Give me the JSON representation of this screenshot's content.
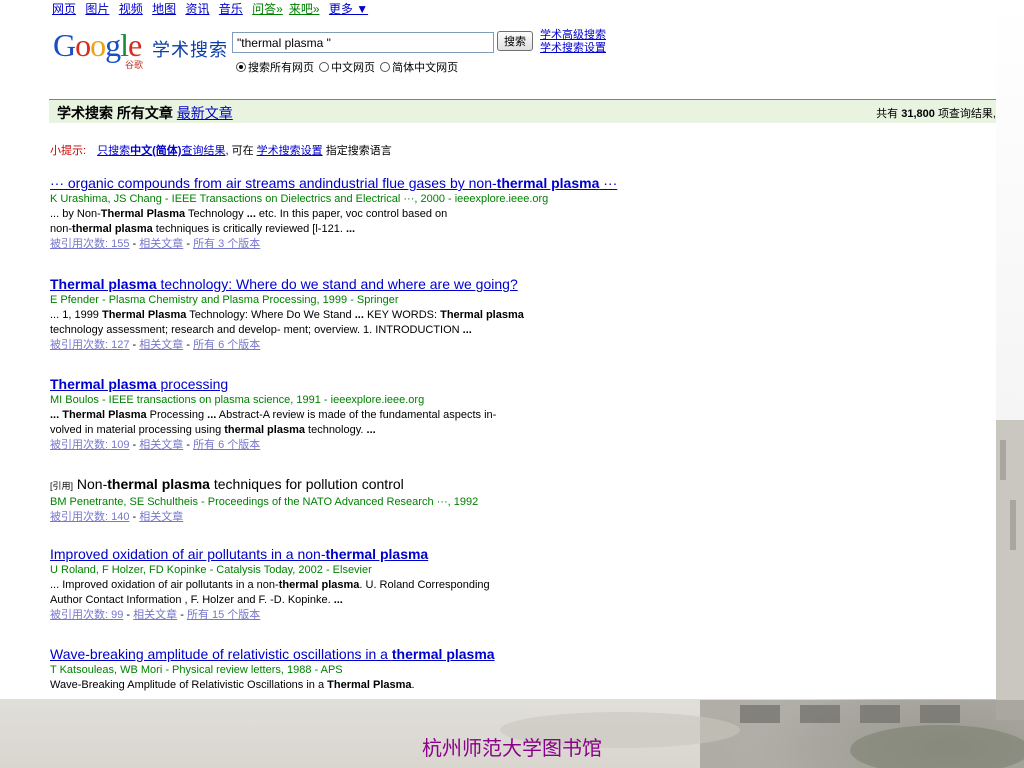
{
  "nav": {
    "items": [
      "网页",
      "图片",
      "视频",
      "地图",
      "资讯",
      "音乐"
    ],
    "wenda": "问答»",
    "laiba": "来吧»",
    "more": "更多 ▼"
  },
  "logo": {
    "word": "Google",
    "sub": "谷歌"
  },
  "scholar_title": "学术搜索",
  "search": {
    "query": "\"thermal plasma \"",
    "button": "搜索"
  },
  "adv": {
    "advanced": "学术高级搜索",
    "settings": "学术搜索设置"
  },
  "scope": {
    "all": "搜索所有网页",
    "cn": "中文网页",
    "simplified": "简体中文网页"
  },
  "bar": {
    "title": "学术搜索",
    "all_articles": "所有文章",
    "newest": "最新文章",
    "count_prefix": "共有",
    "count": "31,800",
    "count_suffix": "项查询结果,"
  },
  "tip": {
    "label": "小提示:",
    "link_pre": "只搜索",
    "link_bold": "中文(简体)",
    "link_post": "查询结果",
    "mid": ", 可在",
    "settings": "学术搜索设置",
    "end": "指定搜索语言"
  },
  "results": [
    {
      "t1": "··· organic compounds from air streams andindustrial flue gases by non-",
      "tb": "thermal plasma",
      "t2": " ···",
      "meta": "K Urashima, JS Chang - IEEE Transactions on Dielectrics and Electrical ···, 2000 - ieeexplore.ieee.org",
      "s1a": "... by Non-",
      "s1b": "Thermal Plasma",
      "s1c": " Technology ",
      "s1d": "...",
      "s1e": " etc. In this paper, voc control based on",
      "s2a": "non-",
      "s2b": "thermal plasma",
      "s2c": " techniques is critically reviewed [l-121. ",
      "s2d": "...",
      "cited": "被引用次数: 155",
      "related": "相关文章",
      "versions": "所有 3 个版本"
    },
    {
      "t1": "",
      "tb": "Thermal plasma",
      "t2": " technology: Where do we stand and where are we going?",
      "meta": "E Pfender - Plasma Chemistry and Plasma Processing, 1999 - Springer",
      "s1a": "... 1, 1999 ",
      "s1b": "Thermal Plasma",
      "s1c": " Technology: Where Do We Stand ",
      "s1d": "...",
      "s1e": " KEY WORDS: ",
      "s1f": "Thermal plasma",
      "s2a": "technology assessment; research and develop- ment; overview. 1. INTRODUCTION ",
      "s2d": "...",
      "cited": "被引用次数: 127",
      "related": "相关文章",
      "versions": "所有 6 个版本"
    },
    {
      "t1": "",
      "tb": "Thermal plasma",
      "t2": " processing",
      "meta": "MI Boulos - IEEE transactions on plasma science, 1991 - ieeexplore.ieee.org",
      "s1a": "... ",
      "s1b": "Thermal Plasma",
      "s1c": " Processing ",
      "s1d": "...",
      "s1e": " Abstract-A review is made of the fundamental aspects in-",
      "s2a": "volved in material processing using ",
      "s2b": "thermal plasma",
      "s2c": " technology. ",
      "s2d": "...",
      "cited": "被引用次数: 109",
      "related": "相关文章",
      "versions": "所有 6 个版本"
    },
    {
      "tag": "[引用]",
      "t1": " Non-",
      "tb": "thermal plasma",
      "t2": " techniques for pollution control",
      "meta": "BM Penetrante, SE Schultheis - Proceedings of the NATO Advanced Research ···, 1992",
      "cited": "被引用次数: 140",
      "related": "相关文章"
    },
    {
      "t1": "Improved oxidation of air pollutants in a non-",
      "tb": "thermal plasma",
      "t2": "",
      "meta": "U Roland, F Holzer, FD Kopinke - Catalysis Today, 2002 - Elsevier",
      "s1a": "... Improved oxidation of air pollutants in a non-",
      "s1b": "thermal plasma",
      "s1c": ". U. Roland Corresponding",
      "s2a": "Author Contact Information , F. Holzer and F. -D. Kopinke. ",
      "s2d": "...",
      "cited": "被引用次数: 99",
      "related": "相关文章",
      "versions": "所有 15 个版本"
    },
    {
      "t1": "Wave-breaking amplitude of relativistic oscillations in a ",
      "tb": "thermal plasma",
      "t2": "",
      "meta": "T Katsouleas, WB Mori - Physical review letters, 1988 - APS",
      "s1a": "Wave-Breaking Amplitude of Relativistic Oscillations in a ",
      "s1b": "Thermal Plasma",
      "s1c": "."
    }
  ],
  "footer": "杭州师范大学图书馆"
}
